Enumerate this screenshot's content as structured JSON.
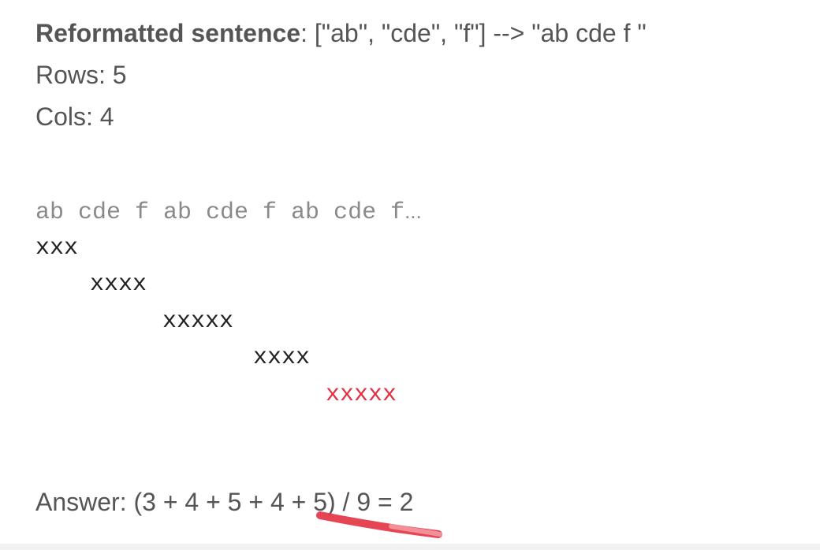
{
  "header": {
    "label": "Reformatted sentence",
    "value": ": [\"ab\", \"cde\", \"f\"] --> \"ab cde f \"",
    "rows_text": "Rows: 5",
    "cols_text": "Cols: 4"
  },
  "sequence": {
    "text": "ab cde f ab cde f ab cde f",
    "ellipsis": "..."
  },
  "rows": [
    {
      "marks": "xxx"
    },
    {
      "marks": "xxxx"
    },
    {
      "marks": "xxxxx"
    },
    {
      "marks": "xxxx"
    },
    {
      "marks": "xxxxx",
      "highlight_color": "#e33040"
    }
  ],
  "answer": {
    "text": "Answer: (3 + 4 + 5 + 4 + 5) / 9 = 2"
  },
  "colors": {
    "text": "#555555",
    "marks": "#222222",
    "highlight": "#e33040",
    "underline": "#e53b4a"
  }
}
